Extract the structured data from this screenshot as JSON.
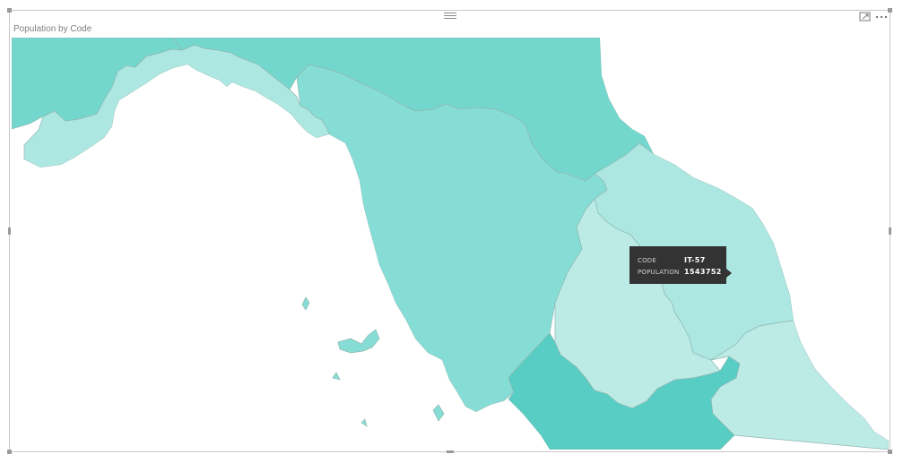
{
  "visual": {
    "title": "Population by Code",
    "header_icons": [
      "drag-grip-icon",
      "focus-mode-icon",
      "more-options-icon"
    ]
  },
  "map": {
    "colors": {
      "dark": "#73d7cd",
      "mid": "#86ddd5",
      "light": "#ade7e1",
      "lighter": "#bcebe6",
      "deep": "#57cdc3",
      "water": "#ffffff",
      "border": "#8fb8b3"
    }
  },
  "tooltip": {
    "code_label": "CODE",
    "code_value": "IT-57",
    "population_label": "POPULATION",
    "population_value": "1543752"
  }
}
